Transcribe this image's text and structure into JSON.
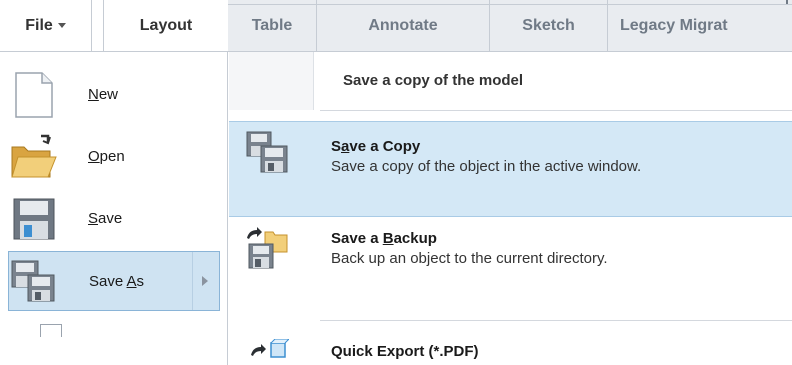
{
  "ribbon": {
    "file": "File",
    "tabs": [
      "Layout",
      "Table",
      "Annotate",
      "Sketch",
      "Legacy Migrat"
    ]
  },
  "left_menu": {
    "items": [
      {
        "pre": "",
        "key": "N",
        "post": "ew",
        "icon": "new-document-icon"
      },
      {
        "pre": "",
        "key": "O",
        "post": "pen",
        "icon": "folder-open-icon"
      },
      {
        "pre": "",
        "key": "S",
        "post": "ave",
        "icon": "floppy-disk-icon"
      },
      {
        "pre": "Save ",
        "key": "A",
        "post": "s",
        "icon": "save-as-icon",
        "selected": true
      }
    ]
  },
  "submenu": {
    "header": "Save a copy of the model",
    "items": [
      {
        "title_pre": "S",
        "title_key": "a",
        "title_post": "ve a Copy",
        "desc": "Save a copy of the object in the active window.",
        "icon": "save-copy-icon",
        "selected": true
      },
      {
        "title_pre": "Save a ",
        "title_key": "B",
        "title_post": "ackup",
        "desc": "Back up an object to the current directory.",
        "icon": "save-backup-icon"
      },
      {
        "title_pre": "Quick Export (*.PDF)",
        "title_key": "",
        "title_post": "",
        "desc": "",
        "icon": "quick-export-icon"
      }
    ]
  }
}
